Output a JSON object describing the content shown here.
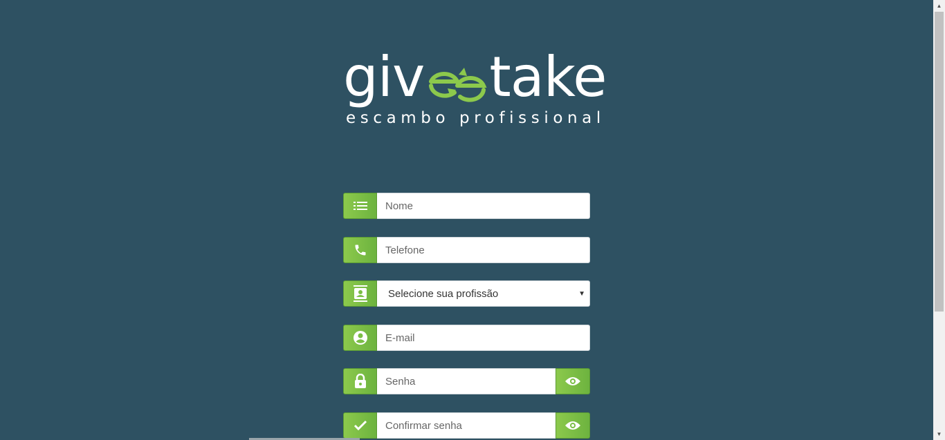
{
  "logo": {
    "word_left": "giv",
    "word_right": "take",
    "tagline": "escambo profissional"
  },
  "form": {
    "name": {
      "placeholder": "Nome",
      "icon": "list-icon"
    },
    "phone": {
      "placeholder": "Telefone",
      "icon": "phone-icon"
    },
    "profession": {
      "selected": "Selecione sua profissão",
      "icon": "contact-card-icon"
    },
    "email": {
      "placeholder": "E-mail",
      "icon": "user-circle-icon"
    },
    "password": {
      "placeholder": "Senha",
      "icon": "lock-icon",
      "toggle_icon": "eye-icon"
    },
    "confirm_password": {
      "placeholder": "Confirmar senha",
      "icon": "check-icon",
      "toggle_icon": "eye-icon"
    }
  },
  "colors": {
    "background": "#2e5162",
    "accent": "#7bbf45",
    "white": "#ffffff"
  }
}
